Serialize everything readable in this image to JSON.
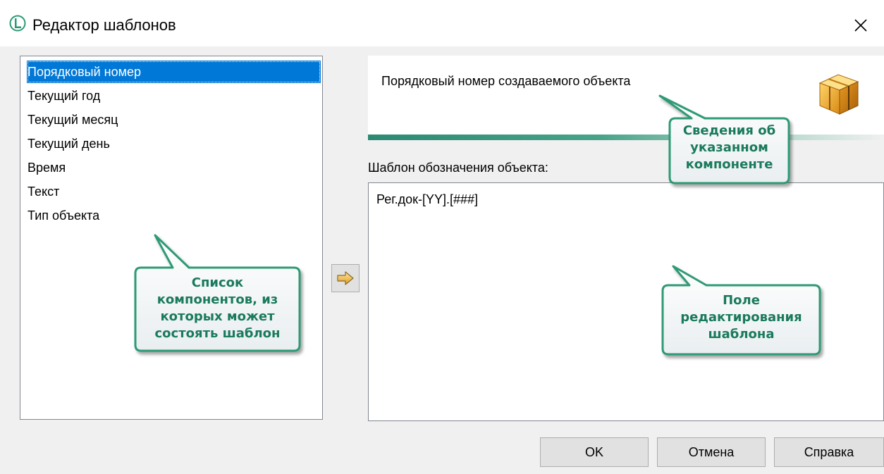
{
  "window": {
    "title": "Редактор шаблонов"
  },
  "components_list": {
    "items": [
      "Порядковый номер",
      "Текущий год",
      "Текущий месяц",
      "Текущий день",
      "Время",
      "Текст",
      "Тип объекта"
    ],
    "selected_index": 0
  },
  "info": {
    "description": "Порядковый номер создаваемого объекта"
  },
  "template": {
    "label": "Шаблон обозначения объекта:",
    "value": "Рег.док-[YY].[###]"
  },
  "buttons": {
    "ok": "OK",
    "cancel": "Отмена",
    "help": "Справка"
  },
  "callouts": {
    "info": [
      "Сведения об",
      "указанном",
      "компоненте"
    ],
    "list": [
      "Список",
      "компонентов, из",
      "которых может",
      "состоять шаблон"
    ],
    "editor": [
      "Поле",
      "редактирования",
      "шаблона"
    ]
  },
  "colors": {
    "selection": "#0078d7",
    "callout_border": "#2e9a75",
    "callout_text": "#1a7a5c"
  }
}
